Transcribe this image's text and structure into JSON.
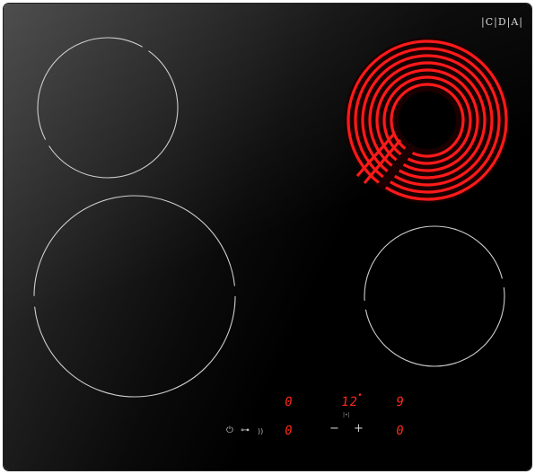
{
  "brand": {
    "logo": "|C|D|A|"
  },
  "colors": {
    "glass": "#000000",
    "element_glow": "#ff1a1a",
    "display": "#ff2a1a",
    "zone_outline": "#d9d9d9"
  },
  "zones": {
    "top_left": {
      "active": false
    },
    "bottom_left": {
      "active": false
    },
    "top_right": {
      "active": true
    },
    "bottom_right": {
      "active": false
    }
  },
  "displays": {
    "top_left_level": "0",
    "top_center_level": "12",
    "top_right_level": "9",
    "bottom_left_level": "0",
    "bottom_right_level": "0"
  },
  "controls": {
    "power_icon": "power-icon",
    "lock_icon": "key-icon",
    "timer_icon": "timer-icon",
    "minus_label": "−",
    "plus_label": "+"
  }
}
